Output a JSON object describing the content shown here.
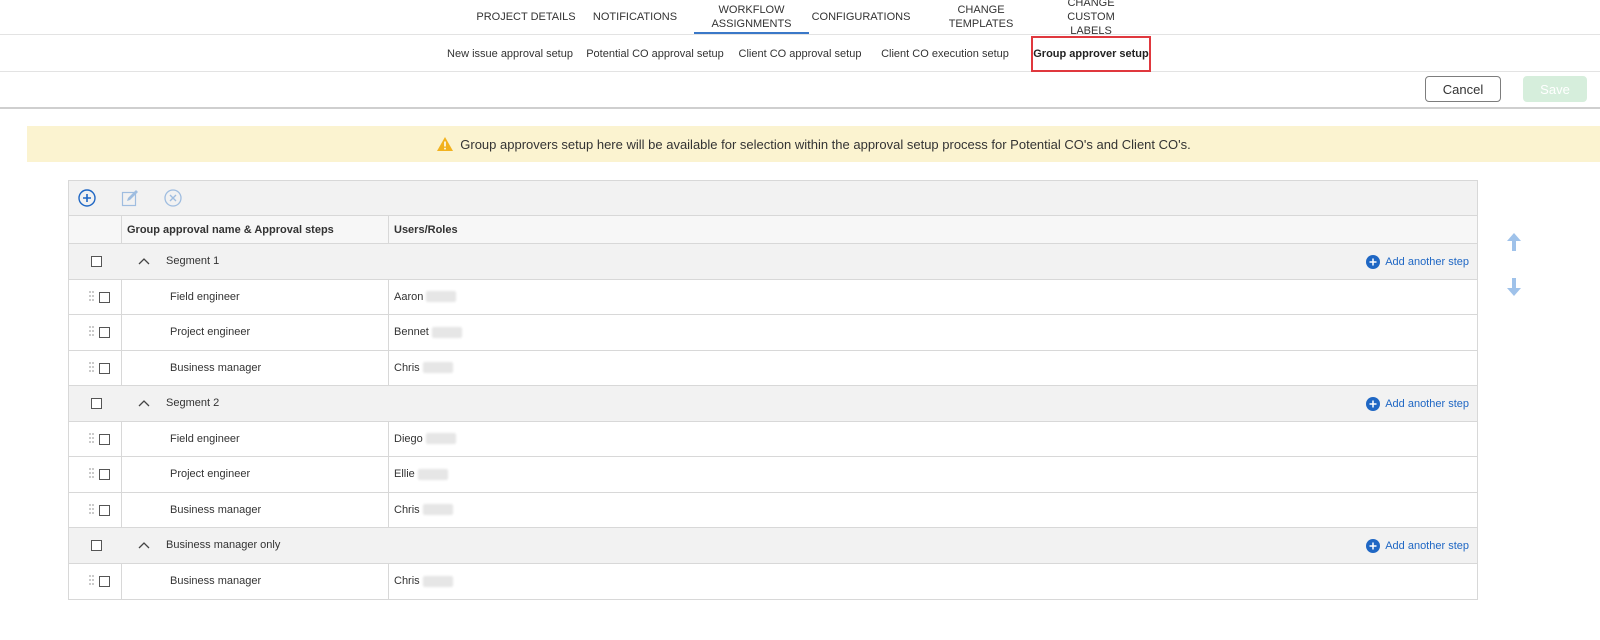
{
  "top_tabs": [
    {
      "label": "PROJECT DETAILS"
    },
    {
      "label": "NOTIFICATIONS"
    },
    {
      "label": "WORKFLOW ASSIGNMENTS",
      "active": true
    },
    {
      "label": "CONFIGURATIONS"
    },
    {
      "label": "CHANGE TEMPLATES"
    },
    {
      "label": "CHANGE CUSTOM LABELS"
    }
  ],
  "sub_tabs": [
    {
      "label": "New issue approval setup"
    },
    {
      "label": "Potential CO approval setup"
    },
    {
      "label": "Client CO approval setup"
    },
    {
      "label": "Client CO execution setup"
    },
    {
      "label": "Group approver setup",
      "active": true
    }
  ],
  "actions": {
    "cancel_label": "Cancel",
    "save_label": "Save"
  },
  "banner": {
    "text": "Group approvers setup here will be available for selection within the approval setup process for Potential CO's and Client CO's."
  },
  "grid": {
    "headers": {
      "name": "Group approval name & Approval steps",
      "users": "Users/Roles"
    },
    "add_step_label": "Add another step",
    "groups": [
      {
        "name": "Segment 1",
        "steps": [
          {
            "step": "Field engineer",
            "user": "Aaron"
          },
          {
            "step": "Project engineer",
            "user": "Bennet"
          },
          {
            "step": "Business manager",
            "user": "Chris"
          }
        ]
      },
      {
        "name": "Segment 2",
        "steps": [
          {
            "step": "Field engineer",
            "user": "Diego"
          },
          {
            "step": "Project engineer",
            "user": "Ellie"
          },
          {
            "step": "Business manager",
            "user": "Chris"
          }
        ]
      },
      {
        "name": "Business manager only",
        "steps": [
          {
            "step": "Business manager",
            "user": "Chris"
          }
        ]
      }
    ]
  },
  "colors": {
    "accent": "#1f67c4",
    "highlight": "#e0383e",
    "banner_bg": "#fbf3d0",
    "warning": "#f2b21e"
  }
}
